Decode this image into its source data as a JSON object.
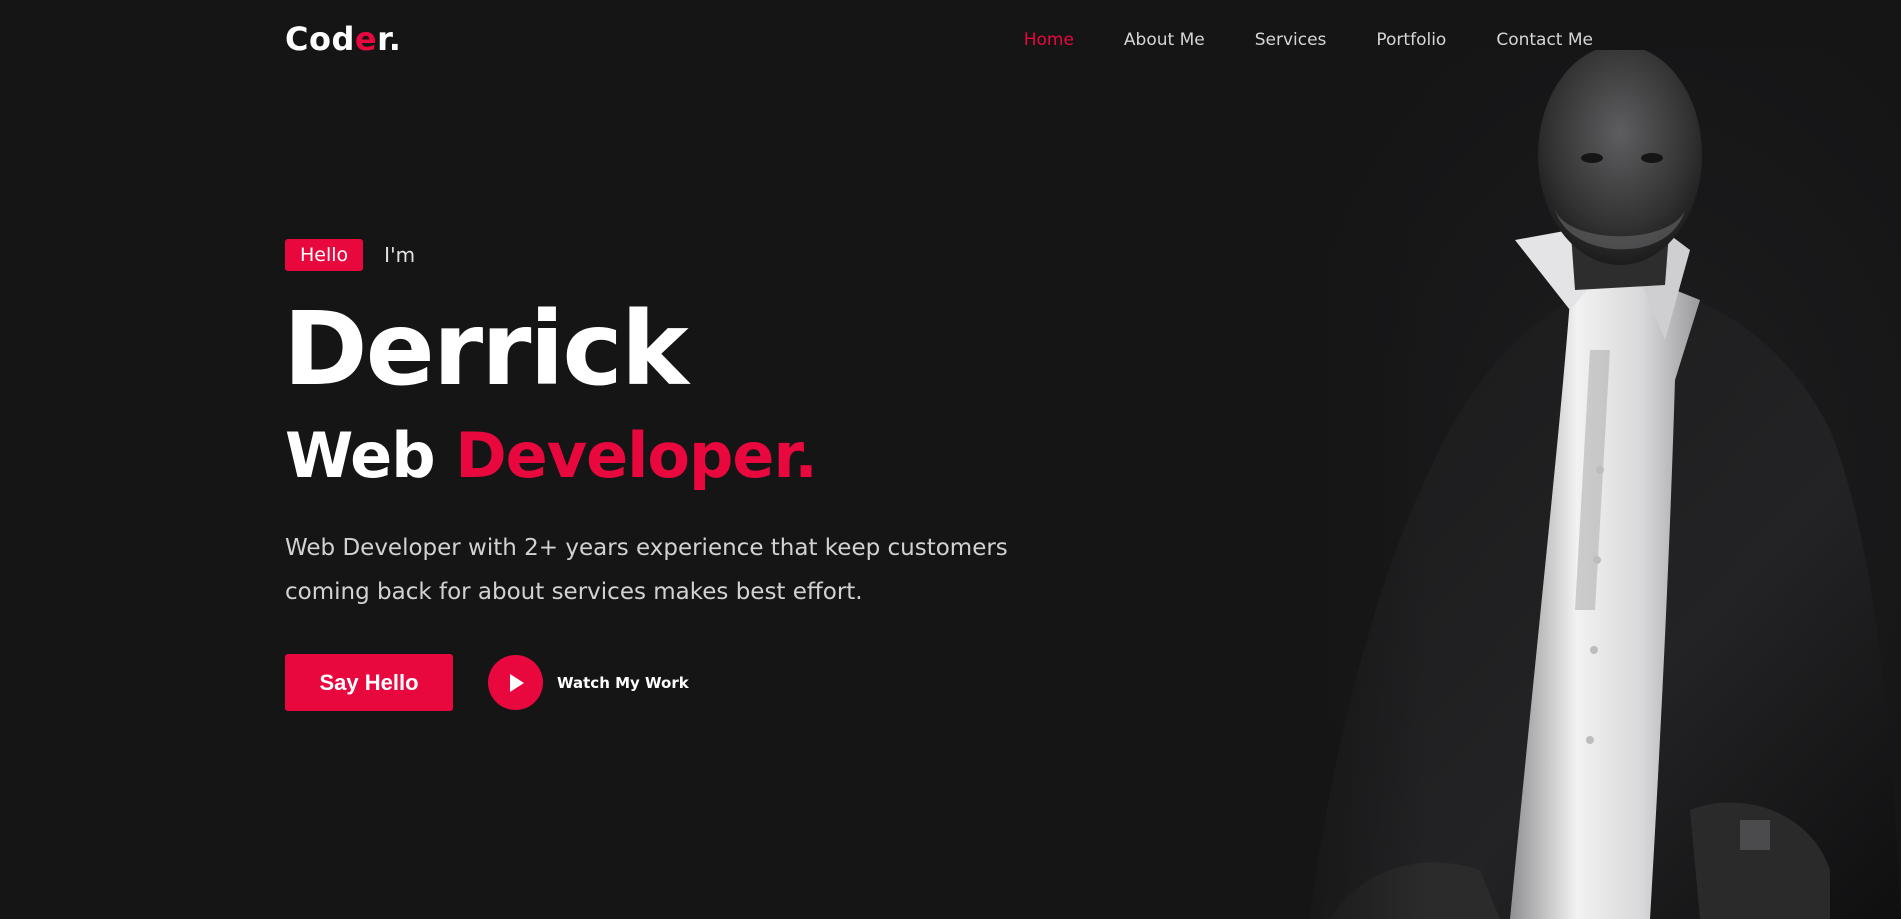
{
  "header": {
    "logo": {
      "prefix": "Cod",
      "accent": "e",
      "suffix": "r."
    },
    "nav": [
      {
        "label": "Home",
        "active": true
      },
      {
        "label": "About Me",
        "active": false
      },
      {
        "label": "Services",
        "active": false
      },
      {
        "label": "Portfolio",
        "active": false
      },
      {
        "label": "Contact Me",
        "active": false
      }
    ]
  },
  "hero": {
    "badge": "Hello",
    "intro": "I'm",
    "name": "Derrick",
    "role_first": "Web",
    "role_accent": "Developer.",
    "description": "Web Developer with 2+ years experience that keep customers coming back for about services makes best effort.",
    "primary_button": "Say Hello",
    "watch_label": "Watch My Work"
  },
  "portrait": {
    "icon": "person-photo"
  },
  "colors": {
    "background": "#151516",
    "accent": "#e8083e",
    "text": "#ffffff",
    "muted": "#d2d2d2"
  }
}
